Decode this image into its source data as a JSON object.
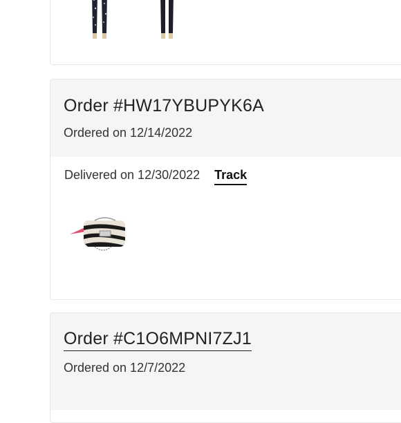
{
  "orders": [
    {
      "items": [
        {
          "thumb": "patterned-leggings-image"
        },
        {
          "thumb": "black-leggings-image"
        }
      ]
    },
    {
      "order_label": "Order #HW17YBUPYK6A",
      "ordered_on": "Ordered on 12/14/2022",
      "delivery_status": "Delivered on 12/30/2022",
      "track_label": "Track",
      "items": [
        {
          "thumb": "zebra-print-handbag-image"
        }
      ]
    },
    {
      "order_label": "Order #C1O6MPNI7ZJ1",
      "ordered_on": "Ordered on 12/7/2022"
    }
  ],
  "colors": {
    "header_bg": "#f5f5f5",
    "card_border": "#e6e6e6",
    "text": "#222222"
  }
}
